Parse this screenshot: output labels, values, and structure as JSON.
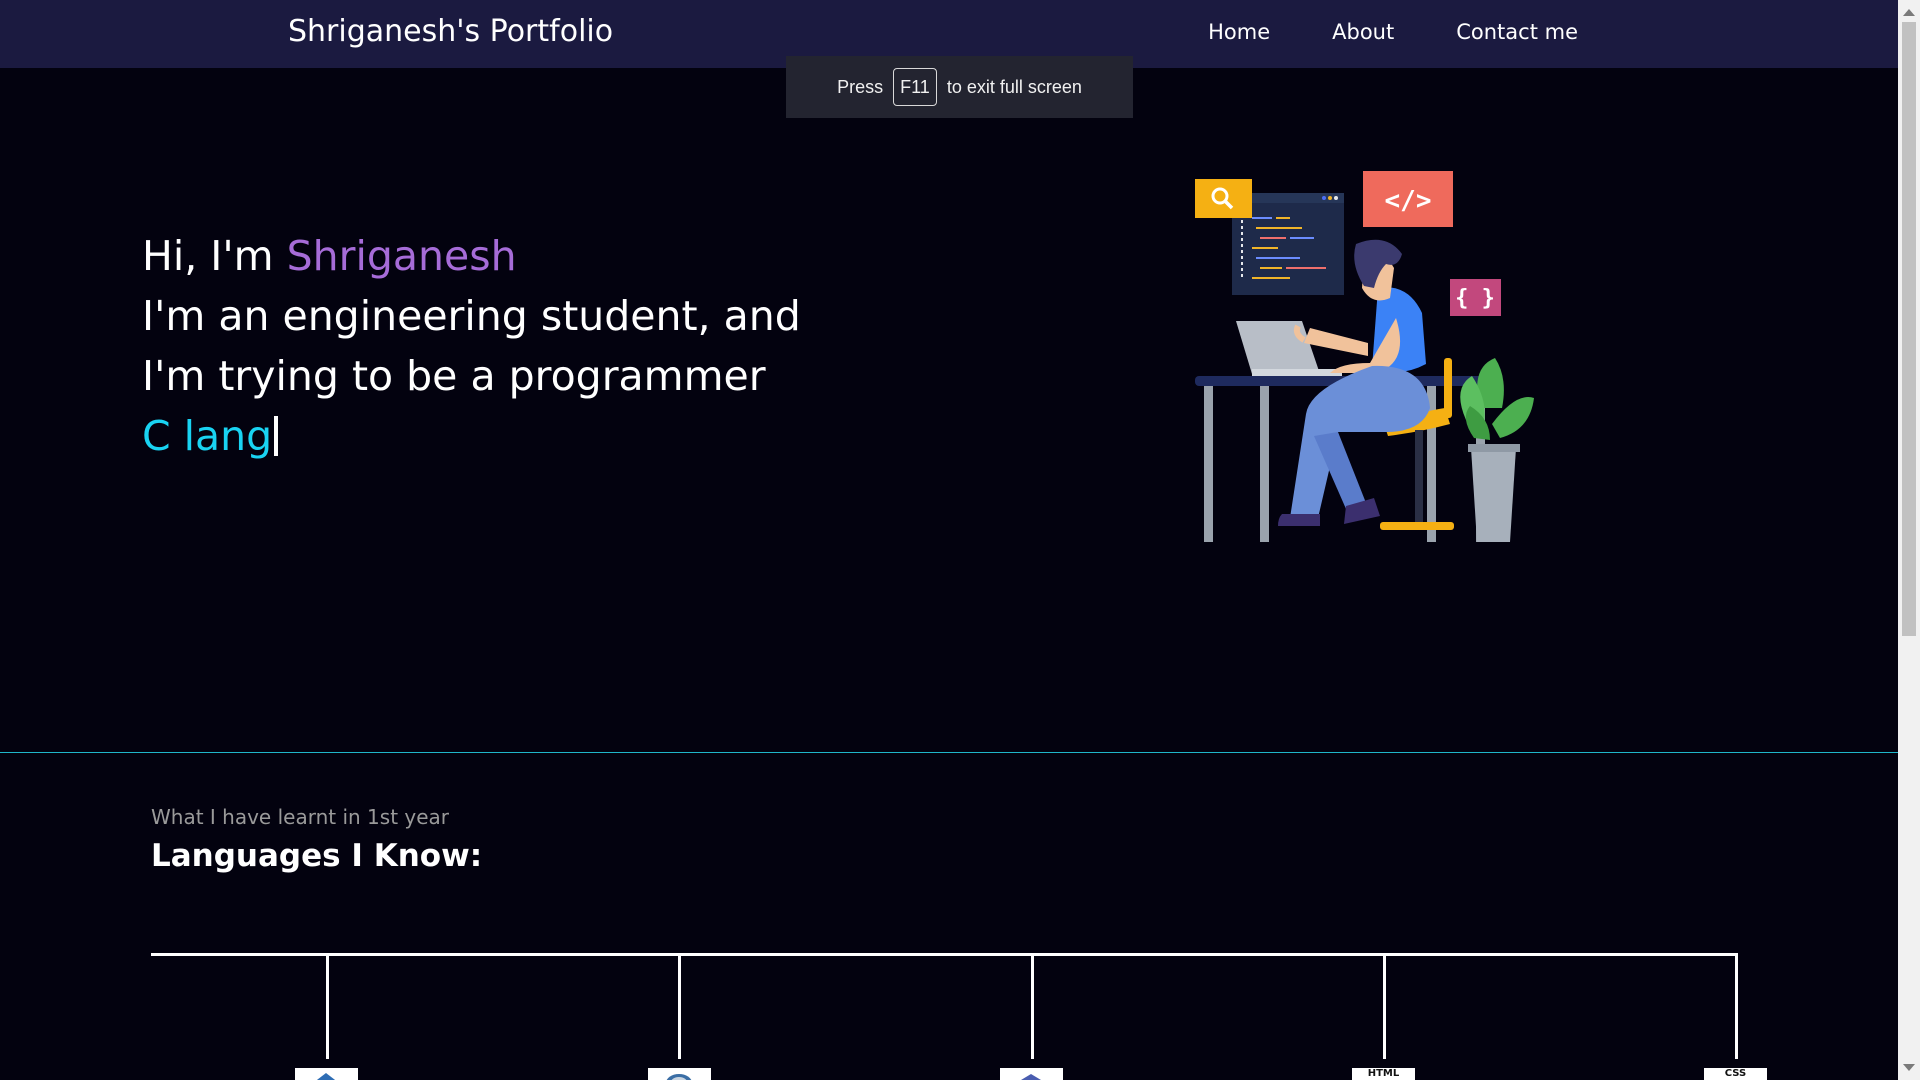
{
  "navbar": {
    "brand": "Shriganesh's Portfolio",
    "links": [
      "Home",
      "About",
      "Contact me"
    ]
  },
  "fullscreen_toast": {
    "prefix": "Press",
    "key": "F11",
    "suffix": "to exit full screen"
  },
  "hero": {
    "greeting": "Hi, I'm ",
    "name": "Shriganesh",
    "line2": "I'm an engineering student, and",
    "line3": "I'm trying to be a programmer",
    "typed_text": "C lang"
  },
  "languages": {
    "subtitle": "What I have learnt in 1st year",
    "title": "Languages I Know:",
    "icons": [
      "",
      "",
      "",
      "HTML",
      "CSS"
    ]
  },
  "colors": {
    "background": "#03020f",
    "navbar": "#1b1a40",
    "name_accent": "#a66cd8",
    "typed_accent": "#19d3f2",
    "divider": "#1fb6c9"
  },
  "illustration": {
    "icons": [
      "search-icon",
      "code-tag-icon",
      "braces-icon"
    ],
    "code_tag": "</>",
    "braces": "{ }"
  }
}
